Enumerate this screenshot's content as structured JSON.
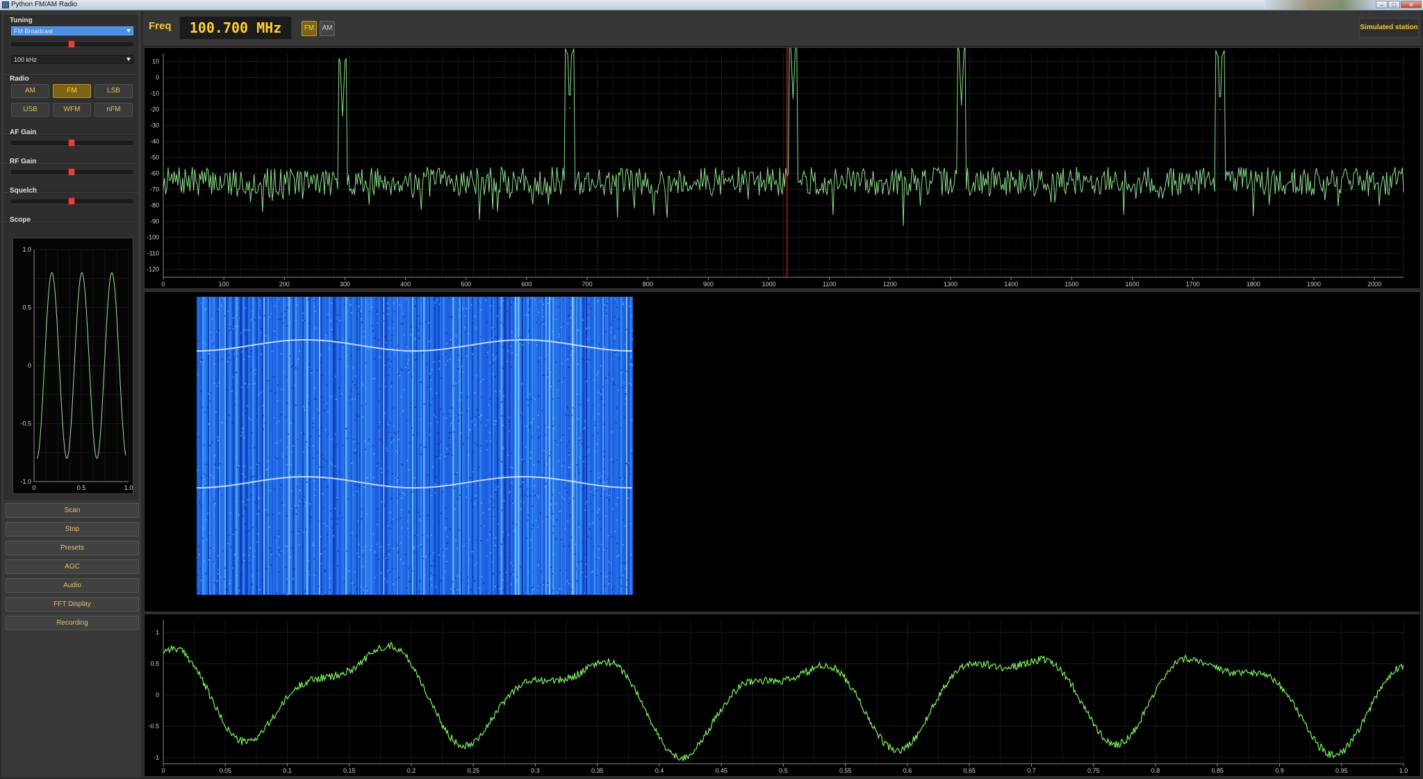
{
  "window": {
    "title": "Python FM/AM Radio",
    "buttons": [
      "–",
      "□",
      "✕"
    ]
  },
  "sidebar": {
    "tuning": {
      "label": "Tuning",
      "band": "FM Broadcast",
      "step": "100 kHz",
      "slider_level": 0.43
    },
    "radio": {
      "label": "Radio",
      "modes": [
        "AM",
        "FM",
        "LSB",
        "USB",
        "WFM",
        "nFM"
      ],
      "active_mode": "FM"
    },
    "af_gain": {
      "label": "AF Gain",
      "level": 0.43
    },
    "rf_gain": {
      "label": "RF Gain",
      "level": 0.43
    },
    "squelch": {
      "label": "Squelch",
      "level": 0.43
    },
    "scope": {
      "label": "Scope",
      "yticks": [
        "1.0",
        "0.5",
        "0",
        "-0.5",
        "-1.0"
      ],
      "xticks": [
        "0",
        "0.5",
        "1.0"
      ]
    },
    "actions": [
      "Scan",
      "Stop",
      "Presets",
      "AGC",
      "Audio",
      "FFT Display",
      "Recording"
    ]
  },
  "toolbar": {
    "freq_label": "Freq",
    "frequency": "100.700 MHz",
    "mode_buttons": [
      "FM",
      "AM"
    ],
    "active_mode": "FM",
    "status": "Simulated station"
  },
  "chart_data": [
    {
      "type": "line",
      "panel": "spectrum",
      "x_range": [
        0,
        2048
      ],
      "ylim": [
        -125,
        15
      ],
      "xticks": [
        0,
        100,
        200,
        300,
        400,
        500,
        600,
        700,
        800,
        900,
        1000,
        1100,
        1200,
        1300,
        1400,
        1500,
        1600,
        1700,
        1800,
        1900,
        2000
      ],
      "yticks": [
        10,
        0,
        -10,
        -20,
        -30,
        -40,
        -50,
        -60,
        -70,
        -80,
        -90,
        -100,
        -110,
        -120
      ],
      "noise_floor": -65,
      "peaks": [
        {
          "x": 296,
          "y": -24
        },
        {
          "x": 671,
          "y": -19
        },
        {
          "x": 1040,
          "y": -13
        },
        {
          "x": 1318,
          "y": -17
        },
        {
          "x": 1745,
          "y": -20
        }
      ],
      "marker_x": 1030,
      "color": "#8fe08f",
      "grid": true
    },
    {
      "type": "heatmap",
      "panel": "waterfall",
      "colormap": "blue",
      "traces": 2
    },
    {
      "type": "line",
      "panel": "audio",
      "x_range": [
        0,
        1
      ],
      "ylim": [
        -1.1,
        1.2
      ],
      "xticks": [
        "0",
        "0.05",
        "0.1",
        "0.15",
        "0.2",
        "0.25",
        "0.3",
        "0.35",
        "0.4",
        "0.45",
        "0.5",
        "0.55",
        "0.6",
        "0.65",
        "0.7",
        "0.75",
        "0.8",
        "0.85",
        "0.9",
        "0.95",
        "1.0"
      ],
      "yticks": [
        "1",
        "0.5",
        "0",
        "-0.5",
        "-1"
      ],
      "color": "#7dfa5c",
      "grid": true
    }
  ]
}
